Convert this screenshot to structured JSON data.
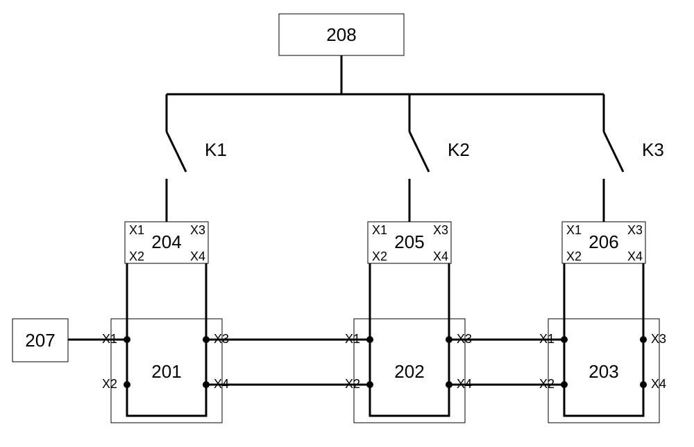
{
  "top_box": "208",
  "left_box": "207",
  "switches": {
    "k1": "K1",
    "k2": "K2",
    "k3": "K3"
  },
  "small_boxes": {
    "b1": "204",
    "b2": "205",
    "b3": "206"
  },
  "big_boxes": {
    "b1": "201",
    "b2": "202",
    "b3": "203"
  },
  "ports": {
    "x1": "X1",
    "x2": "X2",
    "x3": "X3",
    "x4": "X4"
  }
}
